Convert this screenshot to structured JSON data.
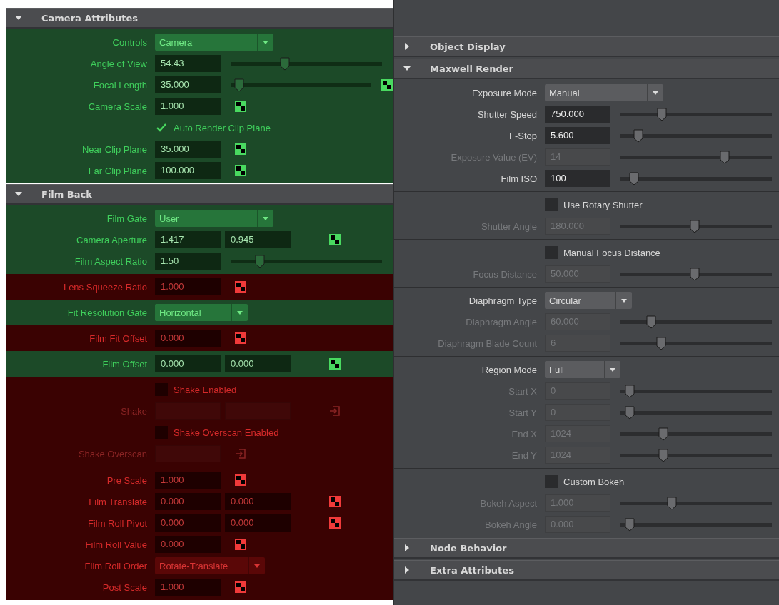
{
  "left_panel": {
    "sections": [
      {
        "title": "Camera Attributes",
        "expanded": true,
        "groups": [
          {
            "color": "#1c4a28",
            "rows": [
              {
                "kind": "dropdown",
                "label": "Controls",
                "value": "Camera",
                "disabled": false,
                "wide": true
              },
              {
                "kind": "field",
                "label": "Angle of View",
                "values": [
                  "54.43"
                ],
                "disabled": false,
                "level": 0.35
              },
              {
                "kind": "field",
                "label": "Focal Length",
                "values": [
                  "35.000"
                ],
                "disabled": false,
                "level": 0.03,
                "map_button": true
              },
              {
                "kind": "field",
                "label": "Camera Scale",
                "values": [
                  "1.000"
                ],
                "disabled": false,
                "map_button": true
              },
              {
                "kind": "checkbox",
                "label": "Auto Render Clip Plane",
                "checked": true,
                "disabled": false
              },
              {
                "kind": "field",
                "label": "Near Clip Plane",
                "values": [
                  "35.000"
                ],
                "disabled": false,
                "map_button": true
              },
              {
                "kind": "field",
                "label": "Far Clip Plane",
                "values": [
                  "100.000"
                ],
                "disabled": false,
                "map_button": true
              }
            ]
          }
        ]
      },
      {
        "title": "Film Back",
        "expanded": true,
        "groups": [
          {
            "color": "#1c4a28",
            "rows": [
              {
                "kind": "dropdown",
                "label": "Film Gate",
                "value": "User",
                "disabled": false,
                "wide": true
              },
              {
                "kind": "field",
                "label": "Camera Aperture",
                "values": [
                  "1.417",
                  "0.945"
                ],
                "disabled": false,
                "map_button": true
              },
              {
                "kind": "field",
                "label": "Film Aspect Ratio",
                "values": [
                  "1.50"
                ],
                "disabled": false,
                "level": 0.17
              }
            ]
          },
          {
            "color": "#3a0202",
            "rows": [
              {
                "kind": "field",
                "label": "Lens Squeeze Ratio",
                "values": [
                  "1.000"
                ],
                "disabled": false,
                "map_button": true
              }
            ]
          },
          {
            "color": "#1c4a28",
            "rows": [
              {
                "kind": "dropdown",
                "label": "Fit Resolution Gate",
                "value": "Horizontal",
                "disabled": false,
                "wide": false
              }
            ]
          },
          {
            "color": "#3a0202",
            "rows": [
              {
                "kind": "field",
                "label": "Film Fit Offset",
                "values": [
                  "0.000"
                ],
                "disabled": false,
                "map_button": true
              }
            ]
          },
          {
            "color": "#1c4a28",
            "rows": [
              {
                "kind": "field",
                "label": "Film Offset",
                "values": [
                  "0.000",
                  "0.000"
                ],
                "disabled": false,
                "map_button": true
              }
            ]
          },
          {
            "color": "#3a0202",
            "rows": [
              {
                "kind": "checkbox",
                "label": "Shake Enabled",
                "checked": false,
                "disabled": false
              },
              {
                "kind": "blank",
                "label": "Shake",
                "fields": [
                  {
                    "disabled": true
                  },
                  {
                    "disabled": true
                  }
                ],
                "disabled": true,
                "connect_button": true
              },
              {
                "kind": "checkbox",
                "label": "Shake Overscan Enabled",
                "checked": false,
                "disabled": false
              },
              {
                "kind": "blank",
                "label": "Shake Overscan",
                "fields": [
                  {
                    "disabled": true
                  }
                ],
                "disabled": true,
                "connect_button": true
              }
            ]
          },
          {
            "color": "#3a0202",
            "rows": [
              {
                "kind": "field",
                "label": "Pre Scale",
                "values": [
                  "1.000"
                ],
                "disabled": false,
                "map_button": true
              },
              {
                "kind": "field",
                "label": "Film Translate",
                "values": [
                  "0.000",
                  "0.000"
                ],
                "disabled": false,
                "map_button": true
              },
              {
                "kind": "field",
                "label": "Film Roll Pivot",
                "values": [
                  "0.000",
                  "0.000"
                ],
                "disabled": false,
                "map_button": true
              },
              {
                "kind": "field",
                "label": "Film Roll Value",
                "values": [
                  "0.000"
                ],
                "disabled": false,
                "map_button": true
              },
              {
                "kind": "dropdown",
                "label": "Film Roll Order",
                "value": "Rotate-Translate",
                "disabled": false,
                "wide": false
              },
              {
                "kind": "field",
                "label": "Post Scale",
                "values": [
                  "1.000"
                ],
                "disabled": false,
                "map_button": true
              }
            ]
          }
        ]
      }
    ]
  },
  "right_panel": {
    "sections": [
      {
        "title": "Object Display",
        "expanded": false
      },
      {
        "title": "Maxwell Render",
        "expanded": true,
        "groups": [
          {
            "color": "#444649",
            "rows": [
              {
                "kind": "dropdown",
                "label": "Exposure Mode",
                "value": "Manual",
                "disabled": false,
                "wide": true
              },
              {
                "kind": "field",
                "label": "Shutter Speed",
                "values": [
                  "750.000"
                ],
                "disabled": false,
                "level": 0.26
              },
              {
                "kind": "field",
                "label": "F-Stop",
                "values": [
                  "5.600"
                ],
                "disabled": false,
                "level": 0.09
              },
              {
                "kind": "field",
                "label": "Exposure Value (EV)",
                "values": [
                  "14"
                ],
                "disabled": true,
                "level": 0.7
              },
              {
                "kind": "field",
                "label": "Film ISO",
                "values": [
                  "100"
                ],
                "disabled": false,
                "level": 0.06
              }
            ]
          },
          {
            "color": "#444649",
            "rows": [
              {
                "kind": "checkbox",
                "label": "Use Rotary Shutter",
                "checked": false,
                "disabled": false
              },
              {
                "kind": "field",
                "label": "Shutter Angle",
                "values": [
                  "180.000"
                ],
                "disabled": true,
                "level": 0.49
              }
            ]
          },
          {
            "color": "#444649",
            "rows": [
              {
                "kind": "checkbox",
                "label": "Manual Focus Distance",
                "checked": false,
                "disabled": false
              },
              {
                "kind": "field",
                "label": "Focus Distance",
                "values": [
                  "50.000"
                ],
                "disabled": true,
                "level": 0.49
              }
            ]
          },
          {
            "color": "#444649",
            "rows": [
              {
                "kind": "dropdown",
                "label": "Diaphragm Type",
                "value": "Circular",
                "disabled": false,
                "wide": false
              },
              {
                "kind": "field",
                "label": "Diaphragm Angle",
                "values": [
                  "60.000"
                ],
                "disabled": true,
                "level": 0.18
              },
              {
                "kind": "field",
                "label": "Diaphragm Blade Count",
                "values": [
                  "6"
                ],
                "disabled": true,
                "level": 0.25
              }
            ]
          },
          {
            "color": "#444649",
            "rows": [
              {
                "kind": "dropdown",
                "label": "Region Mode",
                "value": "Full",
                "disabled": false,
                "wide": false
              },
              {
                "kind": "field",
                "label": "Start X",
                "values": [
                  "0"
                ],
                "disabled": true,
                "level": 0.03
              },
              {
                "kind": "field",
                "label": "Start Y",
                "values": [
                  "0"
                ],
                "disabled": true,
                "level": 0.03
              },
              {
                "kind": "field",
                "label": "End X",
                "values": [
                  "1024"
                ],
                "disabled": true,
                "level": 0.27
              },
              {
                "kind": "field",
                "label": "End Y",
                "values": [
                  "1024"
                ],
                "disabled": true,
                "level": 0.27
              }
            ]
          },
          {
            "color": "#444649",
            "rows": [
              {
                "kind": "checkbox",
                "label": "Custom Bokeh",
                "checked": false,
                "disabled": false
              },
              {
                "kind": "field",
                "label": "Bokeh Aspect",
                "values": [
                  "1.000"
                ],
                "disabled": true,
                "level": 0.33
              },
              {
                "kind": "field",
                "label": "Bokeh Angle",
                "values": [
                  "0.000"
                ],
                "disabled": true,
                "level": 0.03
              }
            ]
          }
        ]
      },
      {
        "title": "Node Behavior",
        "expanded": false
      },
      {
        "title": "Extra Attributes",
        "expanded": false
      }
    ]
  }
}
